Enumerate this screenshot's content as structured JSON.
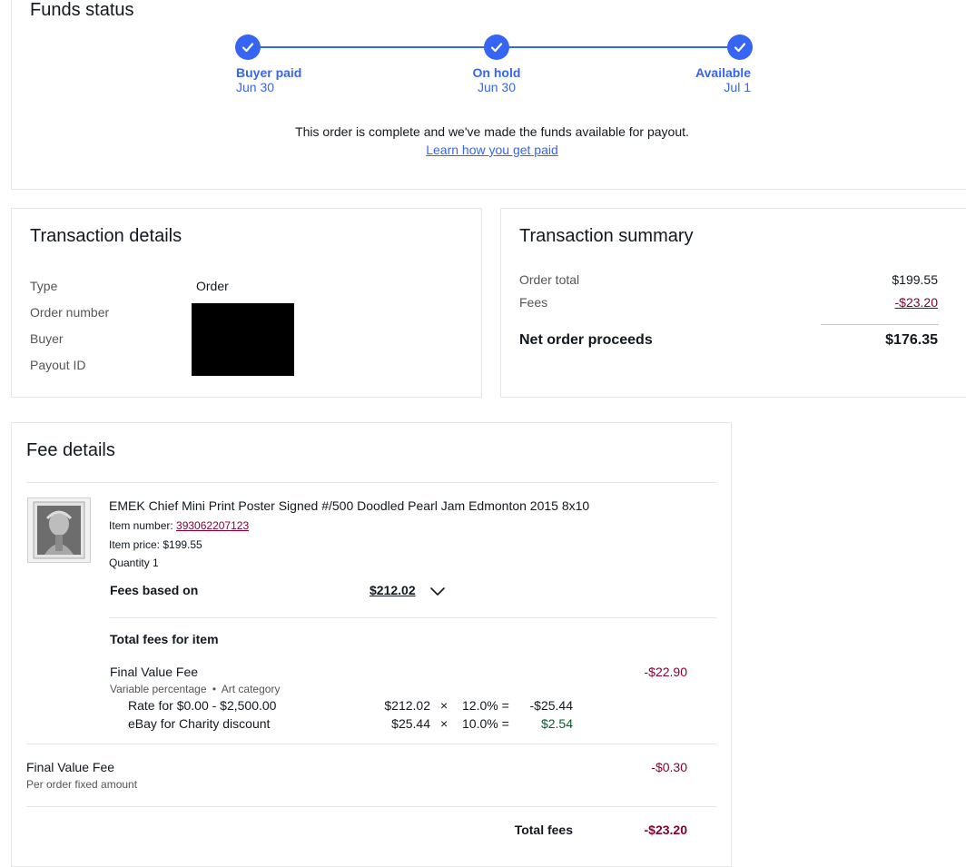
{
  "funds_status": {
    "title": "Funds status",
    "steps": [
      {
        "label": "Buyer paid",
        "date": "Jun 30"
      },
      {
        "label": "On hold",
        "date": "Jun 30"
      },
      {
        "label": "Available",
        "date": "Jul 1"
      }
    ],
    "message": "This order is complete and we've made the funds available for payout.",
    "link": "Learn how you get paid"
  },
  "transaction_details": {
    "title": "Transaction details",
    "rows": [
      {
        "label": "Type",
        "value": "Order"
      },
      {
        "label": "Order number",
        "value": ""
      },
      {
        "label": "Buyer",
        "value": ""
      },
      {
        "label": "Payout ID",
        "value": ""
      }
    ]
  },
  "transaction_summary": {
    "title": "Transaction summary",
    "order_total_label": "Order total",
    "order_total_value": "$199.55",
    "fees_label": "Fees",
    "fees_value": "-$23.20",
    "net_label": "Net order proceeds",
    "net_value": "$176.35"
  },
  "fee_details": {
    "title": "Fee details",
    "item": {
      "title": "EMEK Chief Mini Print Poster Signed #/500 Doodled Pearl Jam Edmonton 2015 8x10",
      "item_number_label": "Item number: ",
      "item_number": "393062207123",
      "item_price": "Item price: $199.55",
      "quantity": "Quantity 1"
    },
    "fees_based_on_label": "Fees based on",
    "fees_based_on_value": "$212.02",
    "total_fees_for_item_label": "Total fees for item",
    "fvf": {
      "label": "Final Value Fee",
      "sub": "Variable percentage",
      "sub_dot": "•",
      "sub_category": "Art category",
      "amount": "-$22.90",
      "rows": [
        {
          "label": "Rate for $0.00 - $2,500.00",
          "base": "$212.02",
          "times": "×",
          "pct": "12.0% =",
          "result": "-$25.44"
        },
        {
          "label": "eBay for Charity discount",
          "base": "$25.44",
          "times": "×",
          "pct": "10.0% =",
          "result": "$2.54"
        }
      ]
    },
    "fixed": {
      "label": "Final Value Fee",
      "sub": "Per order fixed amount",
      "amount": "-$0.30"
    },
    "total_label": "Total fees",
    "total_value": "-$23.20"
  },
  "colors": {
    "accent": "#3665f3",
    "negative": "#860033",
    "positive": "#05622e"
  }
}
